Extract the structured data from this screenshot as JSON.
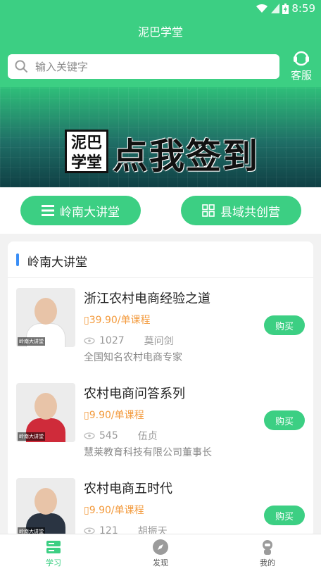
{
  "status_bar": {
    "time": "8:59"
  },
  "header": {
    "title": "泥巴学堂"
  },
  "search": {
    "placeholder": "输入关键字"
  },
  "service": {
    "label": "客服"
  },
  "banner": {
    "logo_text": "泥巴学堂",
    "text": "点我签到"
  },
  "quick_nav": [
    {
      "label": "岭南大讲堂",
      "icon": "list-icon"
    },
    {
      "label": "县域共创营",
      "icon": "grid-icon"
    }
  ],
  "section": {
    "title": "岭南大讲堂"
  },
  "courses": [
    {
      "title": "浙江农村电商经验之道",
      "price": "39.90/单课程",
      "views": "1027",
      "teacher": "莫问剑",
      "desc": "全国知名农村电商专家",
      "thumb_tag": "岭南大讲堂",
      "buy_label": "购买"
    },
    {
      "title": "农村电商问答系列",
      "price": "9.90/单课程",
      "views": "545",
      "teacher": "伍贞",
      "desc": "慧莱教育科技有限公司董事长",
      "thumb_tag": "岭南大讲堂",
      "buy_label": "购买"
    },
    {
      "title": "农村电商五时代",
      "price": "9.90/单课程",
      "views": "121",
      "teacher": "胡振天",
      "desc": "",
      "thumb_tag": "岭南大讲堂",
      "buy_label": "购买"
    }
  ],
  "tabs": [
    {
      "label": "学习",
      "icon": "study-icon",
      "active": true
    },
    {
      "label": "发现",
      "icon": "compass-icon",
      "active": false
    },
    {
      "label": "我的",
      "icon": "user-icon",
      "active": false
    }
  ],
  "colors": {
    "primary": "#3ccf83",
    "price": "#f39a3c",
    "section_bar": "#3a8ef6"
  }
}
